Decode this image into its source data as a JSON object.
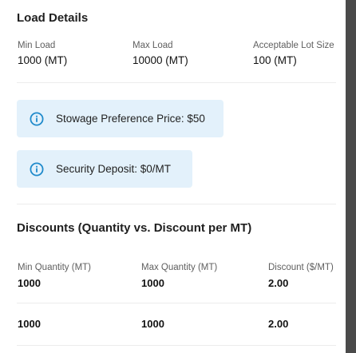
{
  "load_details": {
    "title": "Load Details",
    "min_load": {
      "label": "Min Load",
      "value": "1000 (MT)"
    },
    "max_load": {
      "label": "Max Load",
      "value": "10000 (MT)"
    },
    "lot_size": {
      "label": "Acceptable Lot Size",
      "value": "100 (MT)"
    }
  },
  "notices": {
    "stowage": "Stowage Preference Price: $50",
    "deposit": "Security Deposit: $0/MT"
  },
  "discounts": {
    "title": "Discounts (Quantity vs. Discount per MT)",
    "columns": [
      "Min Quantity (MT)",
      "Max Quantity (MT)",
      "Discount ($/MT)"
    ],
    "rows": [
      [
        "1000",
        "1000",
        "2.00"
      ],
      [
        "1000",
        "1000",
        "2.00"
      ]
    ]
  },
  "colors": {
    "notice_bg": "#e3f1fb",
    "info_icon": "#1f8acb",
    "overlay": "#4b4b4b"
  },
  "icons": [
    "info-circle-icon"
  ]
}
